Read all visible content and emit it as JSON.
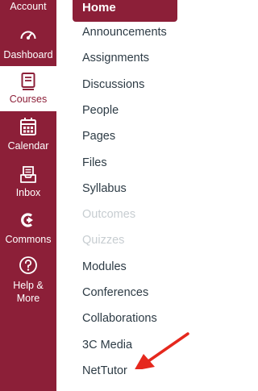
{
  "global_nav": {
    "account": "Account",
    "dashboard": "Dashboard",
    "courses": "Courses",
    "calendar": "Calendar",
    "inbox": "Inbox",
    "commons": "Commons",
    "help_line1": "Help &",
    "help_line2": "More"
  },
  "course_nav": {
    "home": "Home",
    "items": [
      {
        "label": "Announcements",
        "enabled": true
      },
      {
        "label": "Assignments",
        "enabled": true
      },
      {
        "label": "Discussions",
        "enabled": true
      },
      {
        "label": "People",
        "enabled": true
      },
      {
        "label": "Pages",
        "enabled": true
      },
      {
        "label": "Files",
        "enabled": true
      },
      {
        "label": "Syllabus",
        "enabled": true
      },
      {
        "label": "Outcomes",
        "enabled": false
      },
      {
        "label": "Quizzes",
        "enabled": false
      },
      {
        "label": "Modules",
        "enabled": true
      },
      {
        "label": "Conferences",
        "enabled": true
      },
      {
        "label": "Collaborations",
        "enabled": true
      },
      {
        "label": "3C Media",
        "enabled": true
      },
      {
        "label": "NetTutor",
        "enabled": true
      }
    ]
  },
  "colors": {
    "brand": "#8c1f38",
    "link": "#2d3b45",
    "disabled": "#c7cdd1",
    "annotation_arrow": "#e5281d"
  }
}
